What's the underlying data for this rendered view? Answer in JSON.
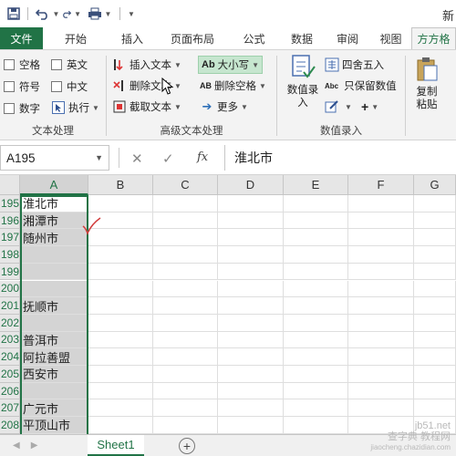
{
  "window": {
    "title": "新"
  },
  "tabs": [
    {
      "label": "文件"
    },
    {
      "label": "开始"
    },
    {
      "label": "插入"
    },
    {
      "label": "页面布局"
    },
    {
      "label": "公式"
    },
    {
      "label": "数据"
    },
    {
      "label": "审阅"
    },
    {
      "label": "视图"
    },
    {
      "label": "方方格"
    }
  ],
  "ribbon": {
    "text_group": {
      "label": "文本处理",
      "items": [
        "空格",
        "英文",
        "符号",
        "中文",
        "数字",
        "执行"
      ]
    },
    "adv_group": {
      "label": "高级文本处理",
      "insert": "插入文本",
      "delete": "删除文本",
      "extract": "截取文本",
      "case": "大小写",
      "case_icon": "Ab",
      "del_space": "删除空格",
      "del_space_icon": "AB",
      "more": "更多"
    },
    "num_group": {
      "label": "数值录入",
      "entry": "数值录入",
      "round": "四舍五入",
      "keep": "只保留数值",
      "keep_icon": "Abc"
    },
    "paste": {
      "label": "复制粘贴"
    }
  },
  "formula_bar": {
    "name_box": "A195",
    "cancel": "✕",
    "enter": "✓",
    "fx": "fx",
    "value": "淮北市"
  },
  "grid": {
    "columns": [
      "A",
      "B",
      "C",
      "D",
      "E",
      "F",
      "G"
    ],
    "rows": [
      {
        "num": "195",
        "a": "淮北市"
      },
      {
        "num": "196",
        "a": "湘潭市"
      },
      {
        "num": "197",
        "a": "随州市"
      },
      {
        "num": "198",
        "a": ""
      },
      {
        "num": "199",
        "a": ""
      },
      {
        "num": "200",
        "a": ""
      },
      {
        "num": "201",
        "a": "抚顺市"
      },
      {
        "num": "202",
        "a": ""
      },
      {
        "num": "203",
        "a": "普洱市"
      },
      {
        "num": "204",
        "a": "阿拉善盟"
      },
      {
        "num": "205",
        "a": "西安市"
      },
      {
        "num": "206",
        "a": ""
      },
      {
        "num": "207",
        "a": "广元市"
      },
      {
        "num": "208",
        "a": "平顶山市"
      }
    ]
  },
  "sheets": {
    "tabs": [
      "Sheet1"
    ],
    "add": "+"
  },
  "watermark": {
    "line1": "查字典 教程网",
    "line2": "jiaocheng.chazidian.com",
    "site": "jb51.net"
  },
  "colors": {
    "accent": "#217346",
    "selection": "#d4d4d4",
    "check": "#d23b3b"
  }
}
